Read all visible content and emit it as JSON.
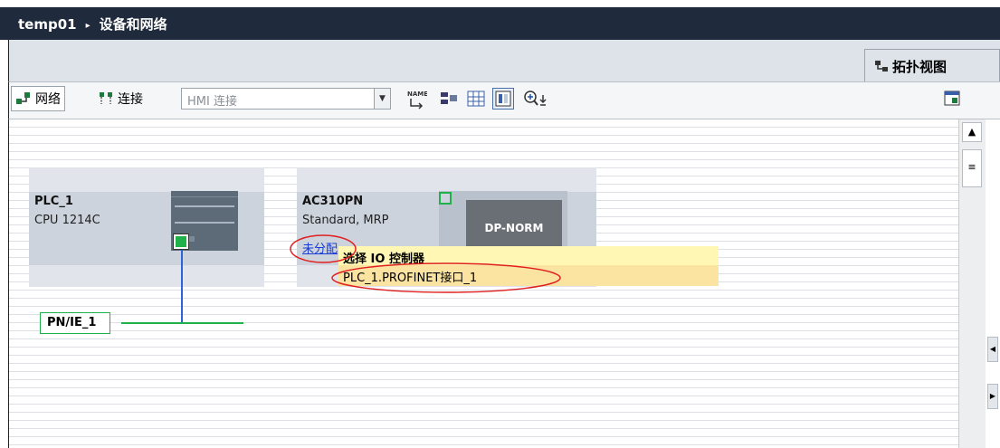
{
  "title": {
    "project": "temp01",
    "separator": "▸",
    "section": "设备和网络"
  },
  "view_tabs": {
    "topology_label": "拓扑视图"
  },
  "toolbar": {
    "network_label": "网络",
    "connect_label": "连接",
    "connection_type_value": "HMI 连接",
    "name_icon_text": "NAME"
  },
  "devices": [
    {
      "name": "PLC_1",
      "type": "CPU 1214C"
    },
    {
      "name": "AC310PN",
      "type": "Standard, MRP",
      "module_label": "DP-NORM",
      "assign_link": "未分配"
    }
  ],
  "subnet": {
    "name": "PN/IE_1"
  },
  "popup": {
    "title": "选择 IO 控制器",
    "option": "PLC_1.PROFINET接口_1"
  },
  "colors": {
    "titlebar": "#1f2a3c",
    "link": "#1a3bd6",
    "port_green": "#21b14b",
    "bus_blue": "#2f63d8",
    "popup_bg": "#fff7b3",
    "highlight_red": "#e02020"
  }
}
